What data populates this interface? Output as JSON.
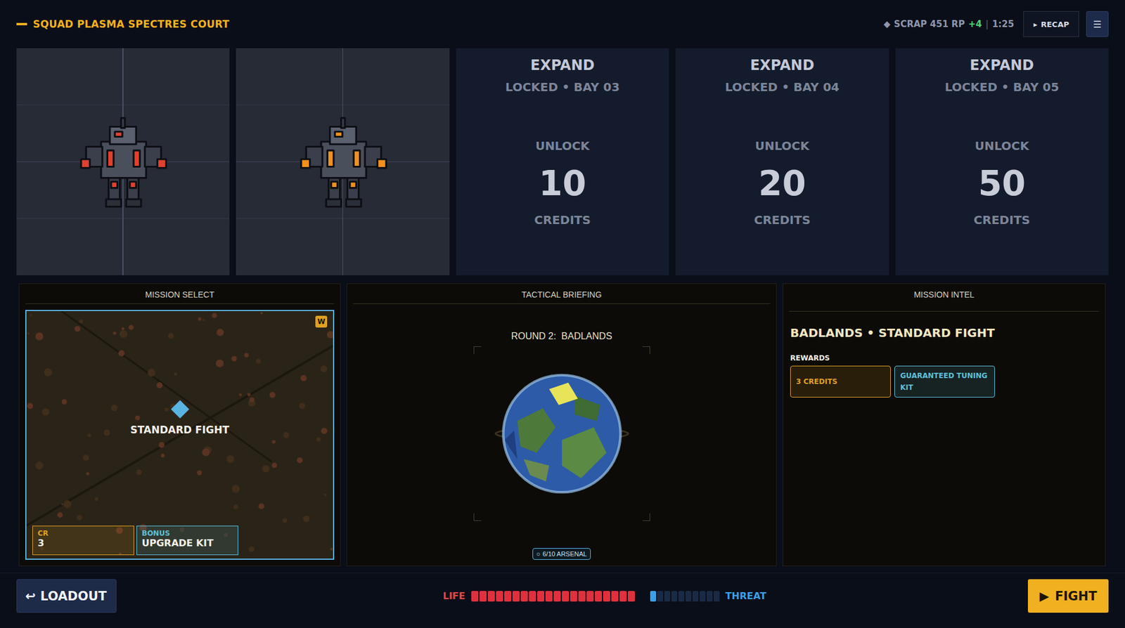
{
  "title": "SQUAD PLASMA SPECTRES COURT",
  "resources": {
    "icon": "◆",
    "label": "SCRAP 451 RP",
    "delta": "+4",
    "separator": "|",
    "timer": "1:25"
  },
  "recap_button": {
    "icon": "▸",
    "label": "RECAP"
  },
  "menu_button": {
    "icon": "☰"
  },
  "bays": [
    {
      "kind": "mech",
      "color": "#e0412f"
    },
    {
      "kind": "mech",
      "color": "#f0901e"
    },
    {
      "kind": "locked",
      "title": "EXPAND",
      "subtitle": "LOCKED • BAY 03",
      "unlock_label": "UNLOCK",
      "cost": "10",
      "unit": "CREDITS"
    },
    {
      "kind": "locked",
      "title": "EXPAND",
      "subtitle": "LOCKED • BAY 04",
      "unlock_label": "UNLOCK",
      "cost": "20",
      "unit": "CREDITS"
    },
    {
      "kind": "locked",
      "title": "EXPAND",
      "subtitle": "LOCKED • BAY 05",
      "unlock_label": "UNLOCK",
      "cost": "50",
      "unit": "CREDITS"
    }
  ],
  "mission_select": {
    "title": "MISSION SELECT",
    "missions": [
      {
        "label": "STANDARD FIGHT",
        "badge": "W",
        "selected": true,
        "stats": [
          {
            "label": "CR",
            "value": "3",
            "color": "#e0a020"
          },
          {
            "label": "BONUS",
            "value": "UPGRADE KIT",
            "color": "#5fc0d8"
          }
        ]
      }
    ]
  },
  "briefing": {
    "title": "TACTICAL BRIEFING",
    "round": "ROUND 2:  BADLANDS",
    "arsenal_icon": "○",
    "arsenal": "6/10 ARSENAL"
  },
  "intel": {
    "title": "MISSION INTEL",
    "heading": "BADLANDS • STANDARD FIGHT",
    "rewards_label": "REWARDS",
    "rewards": [
      {
        "label": "3 CREDITS",
        "color": "#e0a020"
      },
      {
        "label": "GUARANTEED TUNING KIT",
        "color": "#5fc0d8"
      }
    ]
  },
  "footer": {
    "loadout": {
      "icon": "↩",
      "label": "LOADOUT"
    },
    "life": {
      "label": "LIFE",
      "level": 1,
      "segments": 20
    },
    "threat": {
      "label": "THREAT",
      "level": 0.1,
      "segments": 10
    },
    "fight": {
      "icon": "▶",
      "label": "FIGHT"
    }
  }
}
